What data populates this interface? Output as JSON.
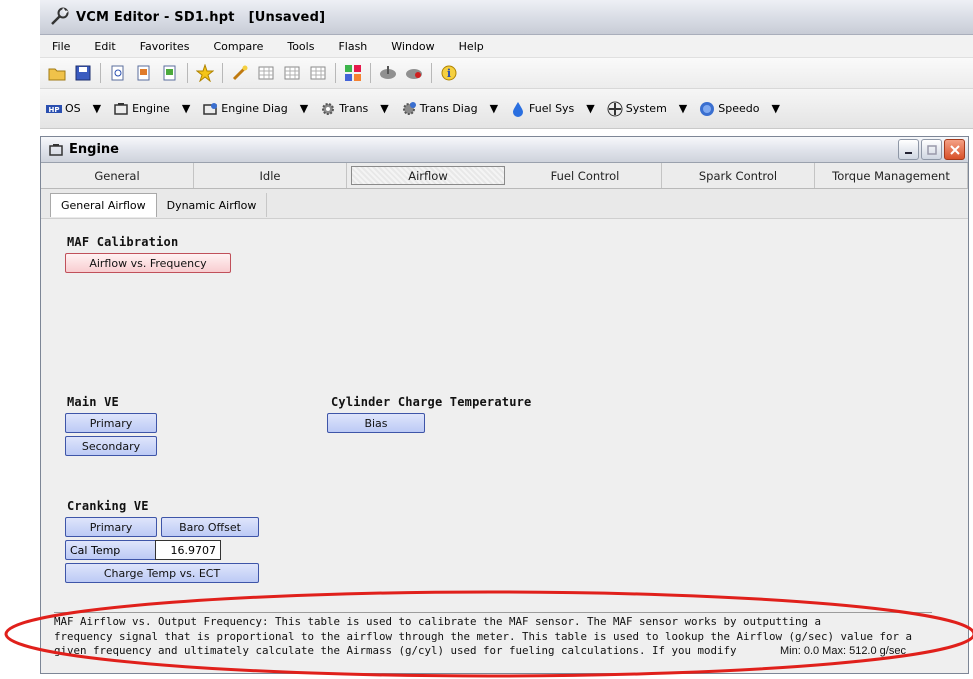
{
  "app": {
    "title": "VCM Editor - SD1.hpt",
    "state": "[Unsaved]"
  },
  "menu": [
    "File",
    "Edit",
    "Favorites",
    "Compare",
    "Tools",
    "Flash",
    "Window",
    "Help"
  ],
  "toolbar_icons": [
    "open-folder-icon",
    "save-icon",
    "print-preview-icon",
    "page-icon",
    "page-edit-icon",
    "favorites-star-icon",
    "wand-icon",
    "table-icon",
    "table-icon",
    "table-icon",
    "compare-icon",
    "read-icon",
    "write-icon",
    "info-icon"
  ],
  "modules": [
    {
      "label": "OS",
      "icon": "hp-os-icon"
    },
    {
      "label": "Engine",
      "icon": "engine-icon"
    },
    {
      "label": "Engine Diag",
      "icon": "engine-diag-icon"
    },
    {
      "label": "Trans",
      "icon": "gear-icon"
    },
    {
      "label": "Trans Diag",
      "icon": "gear-diag-icon"
    },
    {
      "label": "Fuel Sys",
      "icon": "fuel-drop-icon"
    },
    {
      "label": "System",
      "icon": "fan-icon"
    },
    {
      "label": "Speedo",
      "icon": "speedo-icon"
    }
  ],
  "window": {
    "title": "Engine"
  },
  "tabs": [
    {
      "label": "General"
    },
    {
      "label": "Idle"
    },
    {
      "label": "Airflow",
      "active": true
    },
    {
      "label": "Fuel Control"
    },
    {
      "label": "Spark Control"
    },
    {
      "label": "Torque Management"
    }
  ],
  "subtabs": [
    {
      "label": "General Airflow",
      "active": true
    },
    {
      "label": "Dynamic Airflow"
    }
  ],
  "sections": {
    "maf": {
      "label": "MAF Calibration",
      "button": "Airflow vs. Frequency"
    },
    "main_ve": {
      "label": "Main VE",
      "primary": "Primary",
      "secondary": "Secondary"
    },
    "cct": {
      "label": "Cylinder Charge Temperature",
      "bias": "Bias"
    },
    "cranking": {
      "label": "Cranking VE",
      "primary": "Primary",
      "baro": "Baro Offset",
      "cal_temp_label": "Cal Temp",
      "cal_temp_value": "16.9707",
      "charge_temp": "Charge Temp vs. ECT"
    }
  },
  "description": {
    "line1": "MAF Airflow vs. Output Frequency: This table is used to calibrate the MAF sensor. The MAF sensor works by outputting a",
    "line2": "frequency signal that is proportional to the airflow through the meter. This table is used to lookup the Airflow (g/sec) value for a",
    "line3": "given frequency and ultimately calculate the Airmass (g/cyl) used for fueling calculations. If you modify",
    "minmax": "Min: 0.0 Max: 512.0 g/sec"
  },
  "colors": {
    "annotation": "#e0201b",
    "button_blue": "#bccaf5",
    "button_pink": "#f8cdd0"
  }
}
